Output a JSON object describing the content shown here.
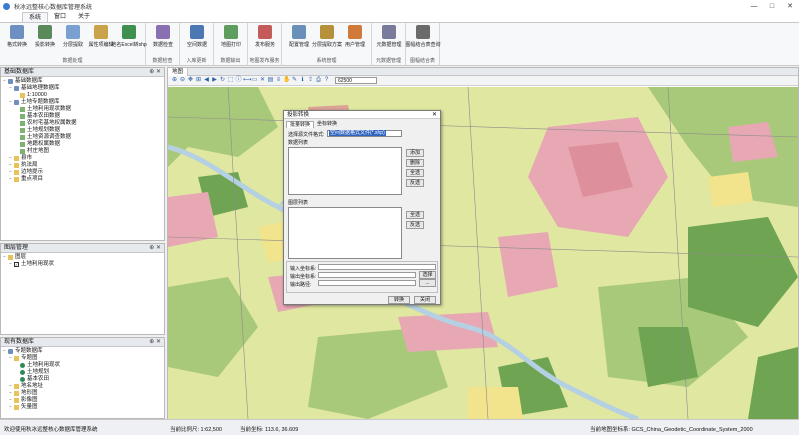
{
  "window": {
    "title": "秋冰远整核心数据库管理系统",
    "controls": [
      "—",
      "□",
      "✕"
    ]
  },
  "menu": {
    "tabs": [
      "系统",
      "窗口",
      "关于"
    ],
    "active_index": 0
  },
  "ribbon": {
    "groups": [
      {
        "name": "数据处理",
        "buttons": [
          {
            "label": "格式转换",
            "icon": "convert-icon",
            "color": "#6d8fc2"
          },
          {
            "label": "投影转换",
            "icon": "projection-icon",
            "color": "#5a8a5a"
          },
          {
            "label": "分层提取",
            "icon": "layer-extract-icon",
            "color": "#7a9fd1"
          },
          {
            "label": "属性项编辑",
            "icon": "edit-icon",
            "color": "#c9a24a"
          },
          {
            "label": "地名Excel转shp",
            "icon": "excel-icon",
            "color": "#3f8f4f"
          }
        ]
      },
      {
        "name": "数据检查",
        "buttons": [
          {
            "label": "数据检查",
            "icon": "check-icon",
            "color": "#8a6fb3"
          }
        ]
      },
      {
        "name": "入库更新",
        "buttons": [
          {
            "label": "空间数据",
            "icon": "spatial-data-icon",
            "color": "#4b78b5"
          }
        ]
      },
      {
        "name": "数据输出",
        "buttons": [
          {
            "label": "地图打印",
            "icon": "print-icon",
            "color": "#5f9d5f"
          }
        ]
      },
      {
        "name": "地图发布服务",
        "buttons": [
          {
            "label": "发布服务",
            "icon": "publish-icon",
            "color": "#c45a5a"
          }
        ]
      },
      {
        "name": "系统管理",
        "buttons": [
          {
            "label": "配置管理",
            "icon": "config-icon",
            "color": "#6a8fb8"
          },
          {
            "label": "分层提取方案",
            "icon": "scheme-icon",
            "color": "#b5923a"
          },
          {
            "label": "用户管理",
            "icon": "user-icon",
            "color": "#d07a3a"
          }
        ]
      },
      {
        "name": "元数据管理",
        "buttons": [
          {
            "label": "元数据管理",
            "icon": "metadata-icon",
            "color": "#7a7a9a"
          }
        ]
      },
      {
        "name": "图幅结合表",
        "buttons": [
          {
            "label": "图幅结合表查询",
            "icon": "sheet-index-icon",
            "color": "#6b6b6b"
          }
        ]
      }
    ]
  },
  "panels": {
    "base_db": {
      "title": "基础数据库",
      "items": [
        {
          "level": 0,
          "label": "基础数据库",
          "icon": "database-icon"
        },
        {
          "level": 1,
          "label": "基础地理数据库",
          "icon": "database-icon"
        },
        {
          "level": 2,
          "label": "1:10000",
          "icon": "folder-icon"
        },
        {
          "level": 1,
          "label": "土地专题数据库",
          "icon": "database-icon"
        },
        {
          "level": 2,
          "label": "土地利用现状数据",
          "icon": "layer-icon"
        },
        {
          "level": 2,
          "label": "基本农田数据",
          "icon": "layer-icon"
        },
        {
          "level": 2,
          "label": "农村宅基地权属数据",
          "icon": "layer-icon"
        },
        {
          "level": 2,
          "label": "土地规划数据",
          "icon": "layer-icon"
        },
        {
          "level": 2,
          "label": "土地资源调查数据",
          "icon": "layer-icon"
        },
        {
          "level": 2,
          "label": "地籍权属数据",
          "icon": "layer-icon"
        },
        {
          "level": 2,
          "label": "村庄地图",
          "icon": "layer-icon"
        },
        {
          "level": 1,
          "label": "县市",
          "icon": "folder-icon"
        },
        {
          "level": 1,
          "label": "执法局",
          "icon": "folder-icon"
        },
        {
          "level": 1,
          "label": "边地提示",
          "icon": "folder-icon"
        },
        {
          "level": 1,
          "label": "重点项目",
          "icon": "folder-icon"
        }
      ]
    },
    "layer_mgr": {
      "title": "图层管理",
      "items": [
        {
          "level": 0,
          "label": "图层",
          "icon": "folder-icon"
        },
        {
          "level": 1,
          "label": "土地利用现状",
          "icon": "checkbox-icon"
        }
      ]
    },
    "current_db": {
      "title": "现有数据库",
      "items": [
        {
          "level": 0,
          "label": "专题数据库",
          "icon": "database-icon"
        },
        {
          "level": 1,
          "label": "专题图",
          "icon": "folder-icon"
        },
        {
          "level": 2,
          "label": "土地利用现状",
          "icon": "globe-icon"
        },
        {
          "level": 2,
          "label": "土地规划",
          "icon": "globe-icon"
        },
        {
          "level": 2,
          "label": "基本农田",
          "icon": "globe-icon"
        },
        {
          "level": 1,
          "label": "地名地址",
          "icon": "folder-icon"
        },
        {
          "level": 1,
          "label": "地形图",
          "icon": "folder-icon"
        },
        {
          "level": 1,
          "label": "影像图",
          "icon": "folder-icon"
        },
        {
          "level": 1,
          "label": "矢量图",
          "icon": "folder-icon"
        }
      ]
    }
  },
  "map": {
    "tab": "地图",
    "tools": [
      "zoom-in-icon",
      "zoom-out-icon",
      "pan-icon",
      "full-extent-icon",
      "previous-icon",
      "next-icon",
      "refresh-icon",
      "select-icon",
      "identify-icon",
      "measure-icon",
      "measure-area-icon",
      "clear-icon",
      "attribute-icon",
      "layer-icon",
      "hand-icon",
      "draw-icon",
      "info-icon",
      "export-icon",
      "print-icon",
      "help-icon"
    ],
    "scale_value": "62500"
  },
  "dialog": {
    "title": "投影转换",
    "tabs": [
      "批量转换",
      "坐标转换"
    ],
    "active_tab": 0,
    "file_format_label": "选择源文件格式:",
    "file_format_value": "空间数据格式文件(*.shp)",
    "data_list_label": "数据列表",
    "list_buttons": [
      "添加",
      "删除",
      "全选",
      "反选"
    ],
    "layer_list_label": "图层列表",
    "layer_buttons": [
      "全选",
      "反选"
    ],
    "input_cs_label": "输入坐标系:",
    "output_cs_label": "输出坐标系:",
    "output_path_label": "输出路径:",
    "browse_button": "选择",
    "path_button": "...",
    "ok_button": "转换",
    "close_button": "关闭",
    "close_icon": "✕"
  },
  "status": {
    "left": "欢迎使用秋冰远整核心数据库管理系统",
    "scale": "当前比例尺: 1:62,500",
    "coords": "当前坐标: 113.6, 36.609",
    "crs": "当前地图坐标系: GCS_China_Geodetic_Coordinate_System_2000"
  },
  "colors": {
    "map_green_light": "#dfe7a0",
    "map_green": "#a9c97a",
    "map_green_dark": "#6fa552",
    "map_pink": "#e7a8b4",
    "map_red": "#d98490",
    "map_yellow": "#f1e48c",
    "map_river": "#b5d0e3"
  }
}
